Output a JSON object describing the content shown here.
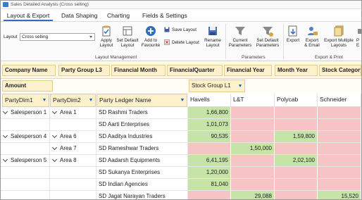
{
  "window": {
    "title": "Sales Detailed Analysis (Cross selling)"
  },
  "ribbon_tabs": [
    "Layout & Export",
    "Data Shaping",
    "Charting",
    "Fields & Settings"
  ],
  "ribbon": {
    "layout_label": "Layout",
    "layout_value": "Cross selling",
    "apply_layout": "Apply\nLayout",
    "set_default_layout": "Set Default\nLayout",
    "add_to_favourite": "Add to\nFavourite",
    "save_layout": "Save Layout",
    "delete_layout": "Delete Layout",
    "rename_layout": "Rename\nLayout",
    "current_parameters": "Current\nParameters",
    "set_default_parameters": "Set Default\nParameters",
    "export": "Export",
    "export_email": "Export\n& Email",
    "export_multiple": "Export Multiple\nLayouts",
    "print": "Print\nPreview",
    "print_extra": "P\nE",
    "group_layout_management": "Layout Management",
    "group_parameters": "Parameters",
    "group_export_print": "Export & Print"
  },
  "filter_fields": [
    "Company Name",
    "Party Group L3",
    "Financial Month",
    "FinancialQuarter",
    "Financial Year",
    "Month Year",
    "Stock Category"
  ],
  "data_field": "Amount",
  "column_field": "Stock Group L1",
  "row_headers": [
    "PartyDim1",
    "PartyDim2",
    "Party Ledger Name"
  ],
  "column_headers": [
    "Havells",
    "L&T",
    "Polycab",
    "Schneider"
  ],
  "rows": [
    {
      "dim1": "Salesperson 1",
      "dim2": "Area 1",
      "ledger": "SD Rashmi Traders",
      "values": [
        "1,66,800",
        "",
        "",
        ""
      ]
    },
    {
      "dim1": "",
      "dim2": "",
      "ledger": "SD Aarti Enterprises",
      "values": [
        "1,01,073",
        "",
        "",
        ""
      ]
    },
    {
      "dim1": "Salesperson 4",
      "dim2": "Area 6",
      "ledger": "SD Aaditya Industries",
      "values": [
        "90,535",
        "",
        "1,59,800",
        ""
      ]
    },
    {
      "dim1": "",
      "dim2": "Area 7",
      "ledger": "SD Rameshwar Traders",
      "values": [
        "",
        "1,50,000",
        "",
        ""
      ]
    },
    {
      "dim1": "Salesperson 5",
      "dim2": "Area 8",
      "ledger": "SD Aadarsh Equipments",
      "values": [
        "6,41,195",
        "",
        "2,02,100",
        ""
      ]
    },
    {
      "dim1": "",
      "dim2": "",
      "ledger": "SD Sukanya Enterprises",
      "values": [
        "1,20,000",
        "",
        "",
        ""
      ]
    },
    {
      "dim1": "",
      "dim2": "",
      "ledger": "SD Indian Agencies",
      "values": [
        "81,040",
        "",
        "",
        ""
      ]
    },
    {
      "dim1": "",
      "dim2": "",
      "ledger": "SD Jagat Narayan Traders",
      "values": [
        "",
        "29,088",
        "",
        "15,520"
      ]
    }
  ],
  "colors": {
    "positive": "#c6e3a8",
    "empty": "#f6c4c4",
    "accent": "#2e6ec0",
    "header_bg": "#fdf1cc"
  }
}
